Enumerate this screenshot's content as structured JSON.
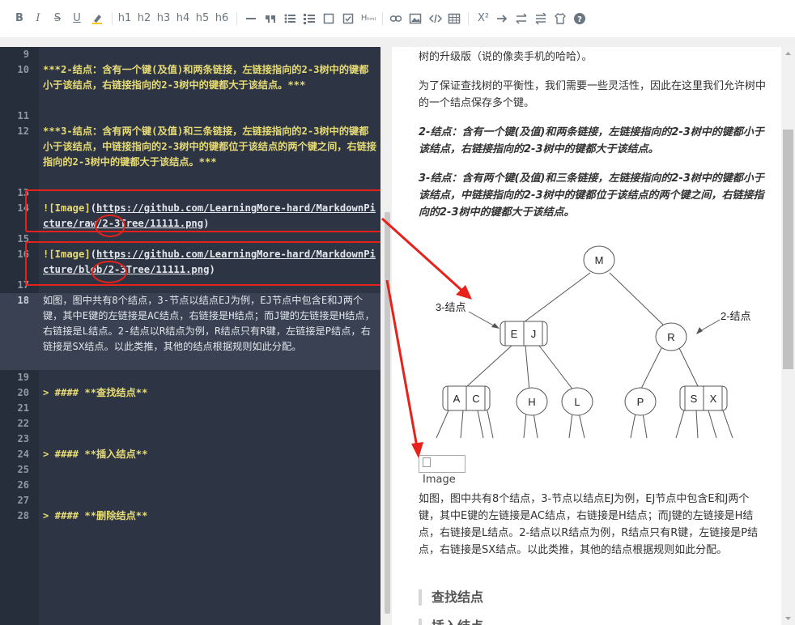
{
  "toolbar": {
    "bold": "B",
    "italic": "I",
    "strike": "S",
    "underline": "U",
    "h1": "h1",
    "h2": "h2",
    "h3": "h3",
    "h4": "h4",
    "h5": "h5",
    "h6": "h6",
    "html": "Hₜₘₗ",
    "superscript": "X²"
  },
  "editor": {
    "lines": [
      {
        "n": "9",
        "text": ""
      },
      {
        "n": "10",
        "text": "***2-结点：含有一个键(及值)和两条链接，左链接指向的2-3树中的键都小于该结点，右链接指向的2-3树中的键都大于该结点。***"
      },
      {
        "n": "11",
        "text": ""
      },
      {
        "n": "12",
        "text": "***3-结点：含有两个键(及值)和三条链接，左链接指向的2-3树中的键都小于该结点，中链接指向的2-3树中的键都位于该结点的两个键之间，右链接指向的2-3树中的键都大于该结点。***"
      },
      {
        "n": "13",
        "text": ""
      },
      {
        "n": "14",
        "img_label": "![Image]",
        "url": "https://github.com/LearningMore-hard/MarkdownPicture/raw/2-3Tree/11111.png"
      },
      {
        "n": "15",
        "text": ""
      },
      {
        "n": "16",
        "img_label": "![Image]",
        "url": "https://github.com/LearningMore-hard/MarkdownPicture/blob/2-3Tree/11111.png"
      },
      {
        "n": "17",
        "text": ""
      },
      {
        "n": "18",
        "text": "如图，图中共有8个结点，3-节点以结点EJ为例，EJ节点中包含E和J两个键，其中E键的左链接是AC结点，右链接是H结点；而J键的左链接是H结点，右链接是L结点。2-结点以R结点为例，R结点只有R键，左链接是P结点，右链接是SX结点。以此类推，其他的结点根据规则如此分配。"
      },
      {
        "n": "19",
        "text": ""
      },
      {
        "n": "20",
        "text": "> #### **查找结点**"
      },
      {
        "n": "21",
        "text": ""
      },
      {
        "n": "22",
        "text": ""
      },
      {
        "n": "23",
        "text": ""
      },
      {
        "n": "24",
        "text": "> #### **插入结点**"
      },
      {
        "n": "25",
        "text": ""
      },
      {
        "n": "26",
        "text": ""
      },
      {
        "n": "27",
        "text": ""
      },
      {
        "n": "28",
        "text": "> #### **删除结点**"
      }
    ]
  },
  "preview": {
    "p_intro": "树的升级版（说的像卖手机的哈哈）。",
    "p_balance": "为了保证查找树的平衡性，我们需要一些灵活性，因此在这里我们允许树中的一个结点保存多个键。",
    "p_2node": "2-结点：含有一个键(及值)和两条链接，左链接指向的2-3树中的键都小于该结点，右链接指向的2-3树中的键都大于该结点。",
    "p_3node": "3-结点：含有两个键(及值)和三条链接，左链接指向的2-3树中的键都小于该结点，中链接指向的2-3树中的键都位于该结点的两个键之间，右链接指向的2-3树中的键都大于该结点。",
    "broken_image_alt": "Image",
    "p_figure": "如图，图中共有8个结点，3-节点以结点EJ为例，EJ节点中包含E和J两个键，其中E键的左链接是AC结点，右链接是H结点；而J键的左链接是H结点，右链接是L结点。2-结点以R结点为例，R结点只有R键，左链接是P结点，右链接是SX结点。以此类推，其他的结点根据规则如此分配。",
    "h_find": "查找结点",
    "h_insert": "插入结点"
  },
  "tree": {
    "root": "M",
    "three_node_label": "3-结点",
    "two_node_label": "2-结点",
    "nodes": {
      "E": "E",
      "J": "J",
      "R": "R",
      "A": "A",
      "C": "C",
      "H": "H",
      "L": "L",
      "P": "P",
      "S": "S",
      "X": "X"
    }
  },
  "colors": {
    "editor_bg": "#2d3443",
    "markdown_yellow": "#e6db74",
    "annotation_red": "#e8221b"
  }
}
